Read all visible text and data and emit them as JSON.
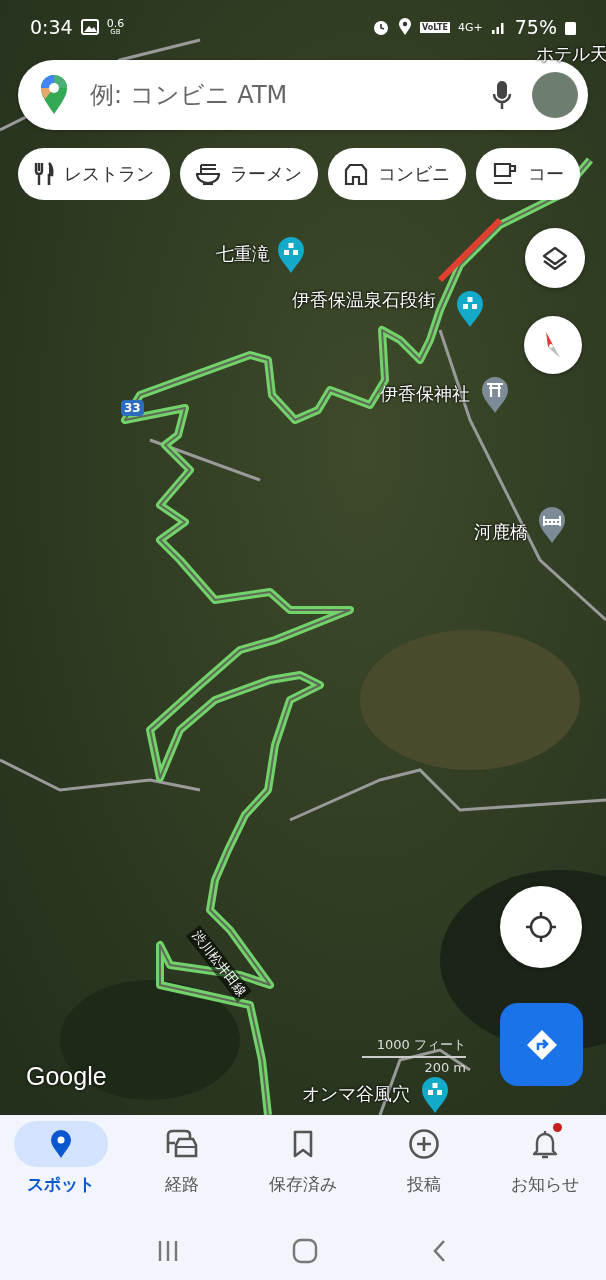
{
  "status_bar": {
    "time": "0:34",
    "data_amount": "0.6",
    "data_unit": "GB",
    "volte": "VoLTE",
    "network": "4G+",
    "battery": "75%"
  },
  "search": {
    "placeholder": "例: コンビニ ATM"
  },
  "chips": [
    {
      "label": "レストラン",
      "kind": "restaurant"
    },
    {
      "label": "ラーメン",
      "kind": "ramen"
    },
    {
      "label": "コンビニ",
      "kind": "store"
    },
    {
      "label": "コー",
      "kind": "cafe"
    }
  ],
  "map": {
    "labels": [
      {
        "text": "ホテル天",
        "kind": "plain"
      },
      {
        "text": "七重滝",
        "kind": "poi"
      },
      {
        "text": "伊香保温泉石段街",
        "kind": "poi"
      },
      {
        "text": "伊香保神社",
        "kind": "shrine"
      },
      {
        "text": "河鹿橋",
        "kind": "bridge"
      },
      {
        "text": "オンマ谷風穴",
        "kind": "poi"
      },
      {
        "text": "渋川松井田線",
        "kind": "road"
      },
      {
        "text": "33",
        "kind": "route"
      }
    ],
    "scale": {
      "imperial": "1000 フィート",
      "metric": "200 m"
    },
    "logo": "Google"
  },
  "nav_tabs": [
    {
      "label": "スポット",
      "kind": "explore",
      "selected": true,
      "badge": false
    },
    {
      "label": "経路",
      "kind": "go",
      "selected": false,
      "badge": false
    },
    {
      "label": "保存済み",
      "kind": "saved",
      "selected": false,
      "badge": false
    },
    {
      "label": "投稿",
      "kind": "contribute",
      "selected": false,
      "badge": false
    },
    {
      "label": "お知らせ",
      "kind": "updates",
      "selected": false,
      "badge": true
    }
  ]
}
